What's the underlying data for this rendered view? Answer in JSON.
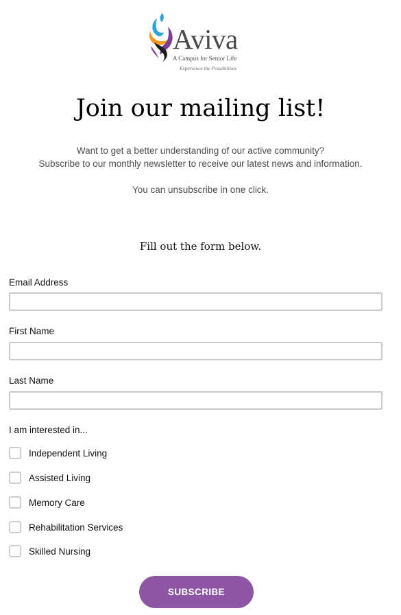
{
  "logo": {
    "wordmark": "Aviva",
    "tagline": "A Campus for Senior Life",
    "motto": "Experience the Possibilities"
  },
  "header": {
    "title": "Join our mailing list!",
    "intro_line1": "Want to get a better understanding of our active community?",
    "intro_line2": "Subscribe to our monthly newsletter to receive our latest news and information.",
    "unsubscribe_note": "You can unsubscribe in one click."
  },
  "form": {
    "heading": "Fill out the form below.",
    "fields": {
      "email": {
        "label": "Email Address",
        "value": ""
      },
      "first_name": {
        "label": "First Name",
        "value": ""
      },
      "last_name": {
        "label": "Last Name",
        "value": ""
      }
    },
    "interests": {
      "label": "I am interested in...",
      "options": [
        {
          "label": "Independent Living",
          "checked": false
        },
        {
          "label": "Assisted Living",
          "checked": false
        },
        {
          "label": "Memory Care",
          "checked": false
        },
        {
          "label": "Rehabilitation Services",
          "checked": false
        },
        {
          "label": "Skilled Nursing",
          "checked": false
        }
      ]
    },
    "submit_label": "SUBSCRIBE"
  },
  "colors": {
    "button": "#8e57a6",
    "input_border": "#c9c9c9",
    "body_text": "#4d4d4d",
    "logo_text": "#4b4b4b",
    "flame_blue": "#29a3d9",
    "flame_orange": "#f39a1f",
    "flame_purple": "#7a3e98",
    "flame_black": "#1a1a1a"
  }
}
